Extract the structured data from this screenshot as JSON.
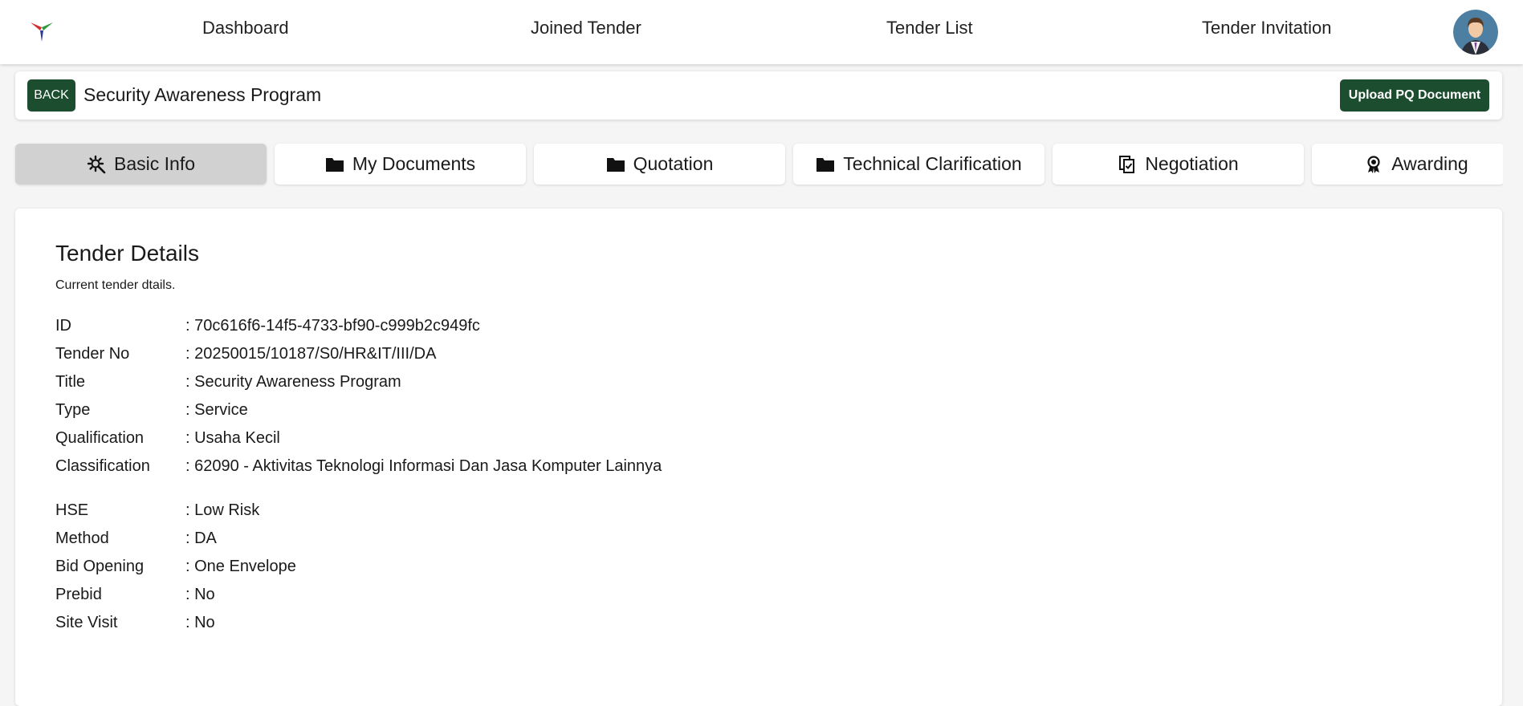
{
  "nav": {
    "items": [
      {
        "label": "Dashboard"
      },
      {
        "label": "Joined Tender"
      },
      {
        "label": "Tender List"
      },
      {
        "label": "Tender Invitation"
      }
    ],
    "avatar_icon": "user-avatar-icon",
    "logo_icon": "brand-logo-icon"
  },
  "header": {
    "back_label": "BACK",
    "title": "Security Awareness Program",
    "upload_label": "Upload PQ Document"
  },
  "tabs": [
    {
      "label": "Basic Info",
      "icon": "gear-icon",
      "active": true
    },
    {
      "label": "My Documents",
      "icon": "folder-icon",
      "active": false
    },
    {
      "label": "Quotation",
      "icon": "folder-icon",
      "active": false
    },
    {
      "label": "Technical Clarification",
      "icon": "folder-icon",
      "active": false
    },
    {
      "label": "Negotiation",
      "icon": "document-check-icon",
      "active": false
    },
    {
      "label": "Awarding",
      "icon": "award-icon",
      "active": false
    }
  ],
  "details": {
    "title": "Tender Details",
    "subtitle": "Current tender dtails.",
    "rows": [
      {
        "label": "ID",
        "value": ": 70c616f6-14f5-4733-bf90-c999b2c949fc"
      },
      {
        "label": "Tender No",
        "value": ": 20250015/10187/S0/HR&IT/III/DA"
      },
      {
        "label": "Title",
        "value": ": Security Awareness Program"
      },
      {
        "label": "Type",
        "value": ": Service"
      },
      {
        "label": "Qualification",
        "value": ": Usaha Kecil"
      },
      {
        "label": "Classification",
        "value": ": 62090 - Aktivitas Teknologi Informasi Dan Jasa Komputer Lainnya"
      },
      {
        "label": "HSE",
        "value": ": Low Risk"
      },
      {
        "label": "Method",
        "value": ": DA"
      },
      {
        "label": "Bid Opening",
        "value": ": One Envelope"
      },
      {
        "label": "Prebid",
        "value": ": No"
      },
      {
        "label": "Site Visit",
        "value": ": No"
      }
    ]
  },
  "colors": {
    "accent": "#1b4d2e",
    "active_tab": "#d1d1d1",
    "background": "#f5f5f5"
  }
}
